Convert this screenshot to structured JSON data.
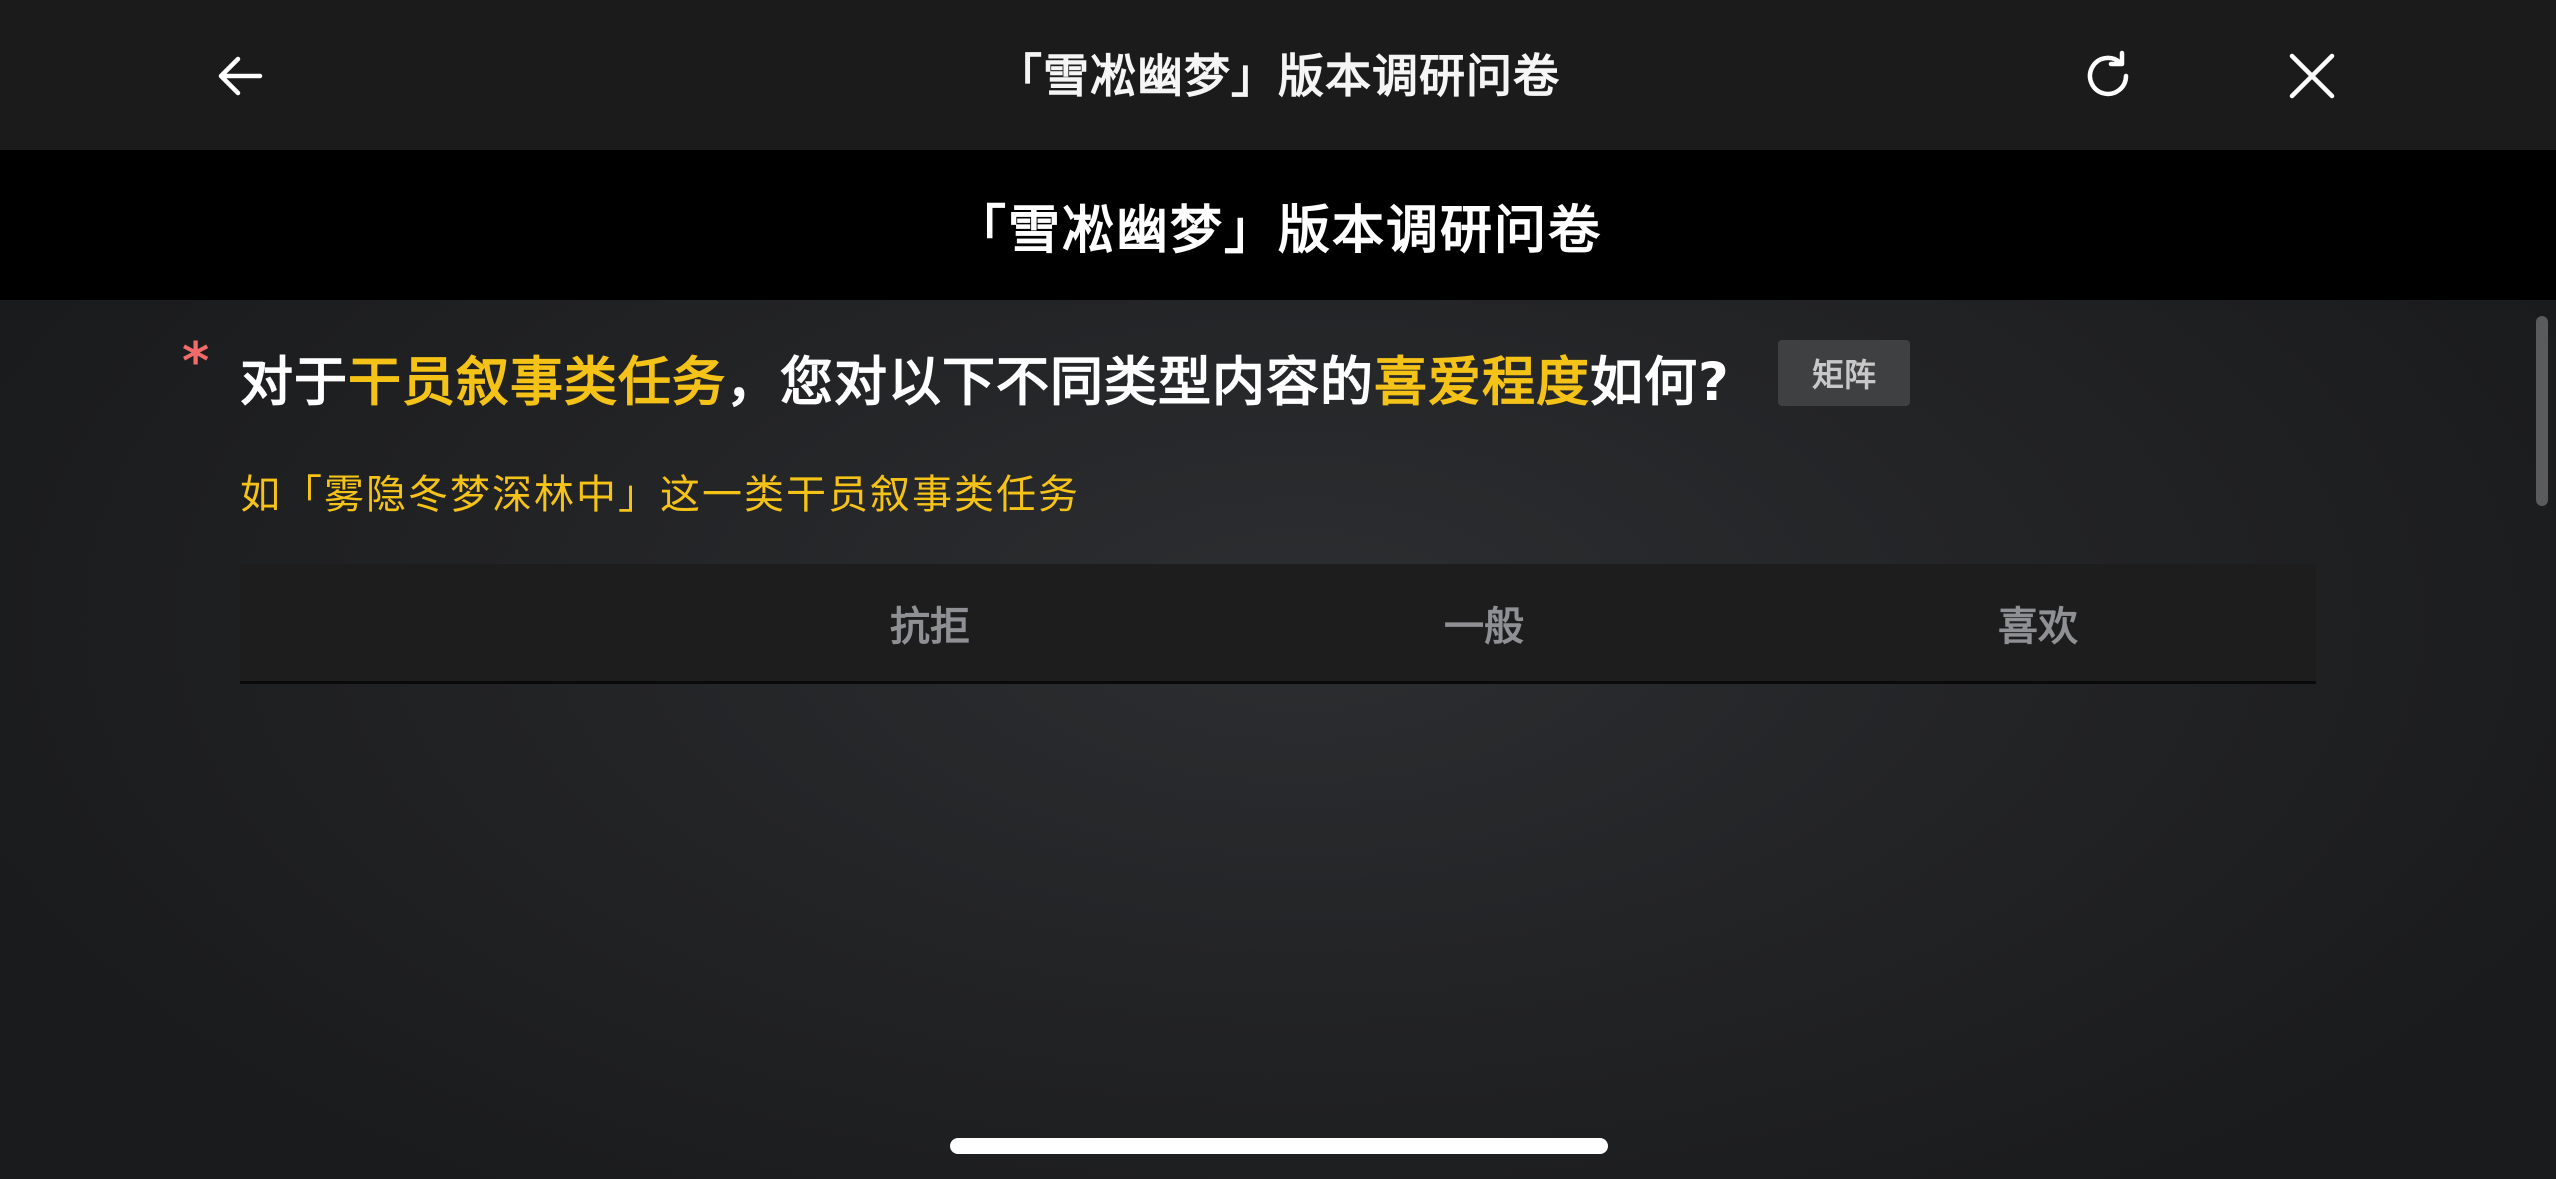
{
  "appbar": {
    "title": "「雪凇幽梦」版本调研问卷",
    "icons": [
      "arrow-left-icon",
      "reload-icon",
      "close-icon"
    ]
  },
  "band": {
    "title": "「雪凇幽梦」版本调研问卷"
  },
  "question": {
    "required_mark": "*",
    "text_1": "对于",
    "highlight_1": "干员叙事类任务",
    "text_2": "，您对以下不同类型内容的",
    "highlight_2": "喜爱程度",
    "text_3": "如何?",
    "tag": "矩阵",
    "hint": "如「雾隐冬梦深林中」这一类干员叙事类任务"
  },
  "matrix": {
    "columns": [
      "抗拒",
      "一般",
      "喜欢"
    ]
  },
  "colors": {
    "highlight": "#f5c218",
    "required": "#f26a6a",
    "appbar_bg": "#1b1b1b",
    "band_bg": "#000000"
  }
}
